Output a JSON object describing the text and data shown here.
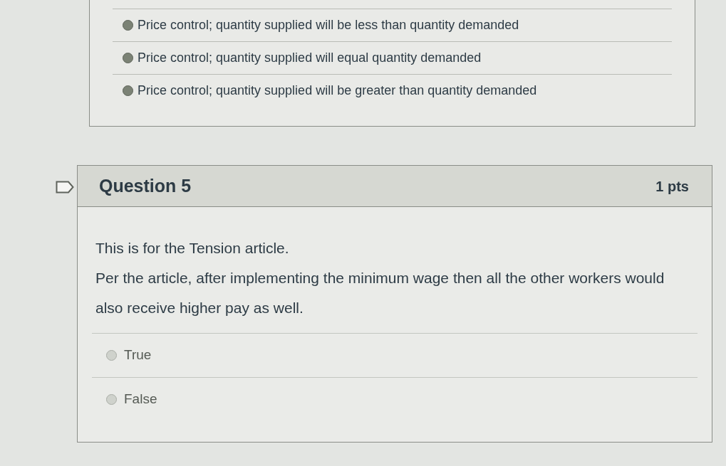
{
  "previous_question": {
    "answers": [
      {
        "label": "Price control; quantity supplied will be less than quantity demanded",
        "selected": false
      },
      {
        "label": "Price control; quantity supplied will equal quantity demanded",
        "selected": false
      },
      {
        "label": "Price control; quantity supplied will be greater than quantity demanded",
        "selected": false
      }
    ]
  },
  "question": {
    "title": "Question 5",
    "points": "1 pts",
    "flagged": false,
    "paragraphs": [
      "This is for the Tension article.",
      "Per the article, after implementing the minimum wage then all the other workers would also receive higher pay as well."
    ],
    "answers": [
      {
        "label": "True",
        "selected": false
      },
      {
        "label": "False",
        "selected": false
      }
    ]
  }
}
